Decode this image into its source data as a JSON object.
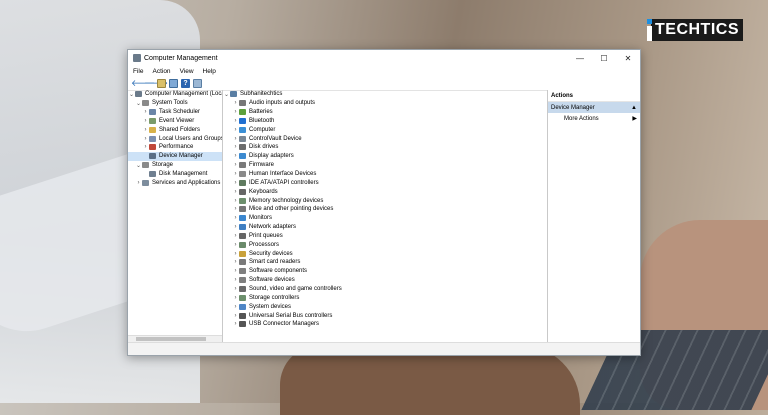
{
  "brand": {
    "logo_text": "TECHTICS"
  },
  "window": {
    "title": "Computer Management",
    "controls": {
      "minimize": "—",
      "maximize": "☐",
      "close": "✕"
    }
  },
  "menu": [
    "File",
    "Action",
    "View",
    "Help"
  ],
  "tree": [
    {
      "label": "Computer Management (Local",
      "level": 1,
      "toggle": "⌄",
      "icon_color": "#6a7a8a",
      "icon": "computer-management-icon"
    },
    {
      "label": "System Tools",
      "level": 2,
      "toggle": "⌄",
      "icon_color": "#8a8a8a",
      "icon": "system-tools-icon"
    },
    {
      "label": "Task Scheduler",
      "level": 3,
      "toggle": "›",
      "icon_color": "#6b86a8",
      "icon": "task-scheduler-icon"
    },
    {
      "label": "Event Viewer",
      "level": 3,
      "toggle": "›",
      "icon_color": "#7a9b6a",
      "icon": "event-viewer-icon"
    },
    {
      "label": "Shared Folders",
      "level": 3,
      "toggle": "›",
      "icon_color": "#d8b24a",
      "icon": "shared-folders-icon"
    },
    {
      "label": "Local Users and Groups",
      "level": 3,
      "toggle": "›",
      "icon_color": "#7b8fb0",
      "icon": "users-icon"
    },
    {
      "label": "Performance",
      "level": 3,
      "toggle": "›",
      "icon_color": "#c0483a",
      "icon": "performance-icon"
    },
    {
      "label": "Device Manager",
      "level": 3,
      "toggle": "",
      "icon_color": "#5b6f86",
      "icon": "device-manager-icon",
      "selected": true
    },
    {
      "label": "Storage",
      "level": 2,
      "toggle": "⌄",
      "icon_color": "#8a8a8a",
      "icon": "storage-icon"
    },
    {
      "label": "Disk Management",
      "level": 3,
      "toggle": "",
      "icon_color": "#6f7f90",
      "icon": "disk-management-icon"
    },
    {
      "label": "Services and Applications",
      "level": 2,
      "toggle": "›",
      "icon_color": "#7d8d9d",
      "icon": "services-icon"
    }
  ],
  "devices": {
    "root": "Subhanitechtics",
    "items": [
      {
        "label": "Audio inputs and outputs",
        "icon_color": "#777777"
      },
      {
        "label": "Batteries",
        "icon_color": "#5da03c"
      },
      {
        "label": "Bluetooth",
        "icon_color": "#1f6fd1"
      },
      {
        "label": "Computer",
        "icon_color": "#3a8fd6"
      },
      {
        "label": "ControlVault Device",
        "icon_color": "#7a8794"
      },
      {
        "label": "Disk drives",
        "icon_color": "#6c6c6c"
      },
      {
        "label": "Display adapters",
        "icon_color": "#3c8ad0"
      },
      {
        "label": "Firmware",
        "icon_color": "#7a7a7a"
      },
      {
        "label": "Human Interface Devices",
        "icon_color": "#8a8a8a"
      },
      {
        "label": "IDE ATA/ATAPI controllers",
        "icon_color": "#5f7a5f"
      },
      {
        "label": "Keyboards",
        "icon_color": "#666666"
      },
      {
        "label": "Memory technology devices",
        "icon_color": "#6d8f6d"
      },
      {
        "label": "Mice and other pointing devices",
        "icon_color": "#777777"
      },
      {
        "label": "Monitors",
        "icon_color": "#3b87cf"
      },
      {
        "label": "Network adapters",
        "icon_color": "#3f7fc2"
      },
      {
        "label": "Print queues",
        "icon_color": "#666666"
      },
      {
        "label": "Processors",
        "icon_color": "#6a8a6a"
      },
      {
        "label": "Security devices",
        "icon_color": "#c9a13a"
      },
      {
        "label": "Smart card readers",
        "icon_color": "#7a7a7a"
      },
      {
        "label": "Software components",
        "icon_color": "#7f7f7f"
      },
      {
        "label": "Software devices",
        "icon_color": "#7f7f7f"
      },
      {
        "label": "Sound, video and game controllers",
        "icon_color": "#6a6a6a"
      },
      {
        "label": "Storage controllers",
        "icon_color": "#6c8f6c"
      },
      {
        "label": "System devices",
        "icon_color": "#4f86c6"
      },
      {
        "label": "Universal Serial Bus controllers",
        "icon_color": "#555555"
      },
      {
        "label": "USB Connector Managers",
        "icon_color": "#555555"
      }
    ]
  },
  "actions": {
    "header": "Actions",
    "section": "Device Manager",
    "item": "More Actions"
  }
}
